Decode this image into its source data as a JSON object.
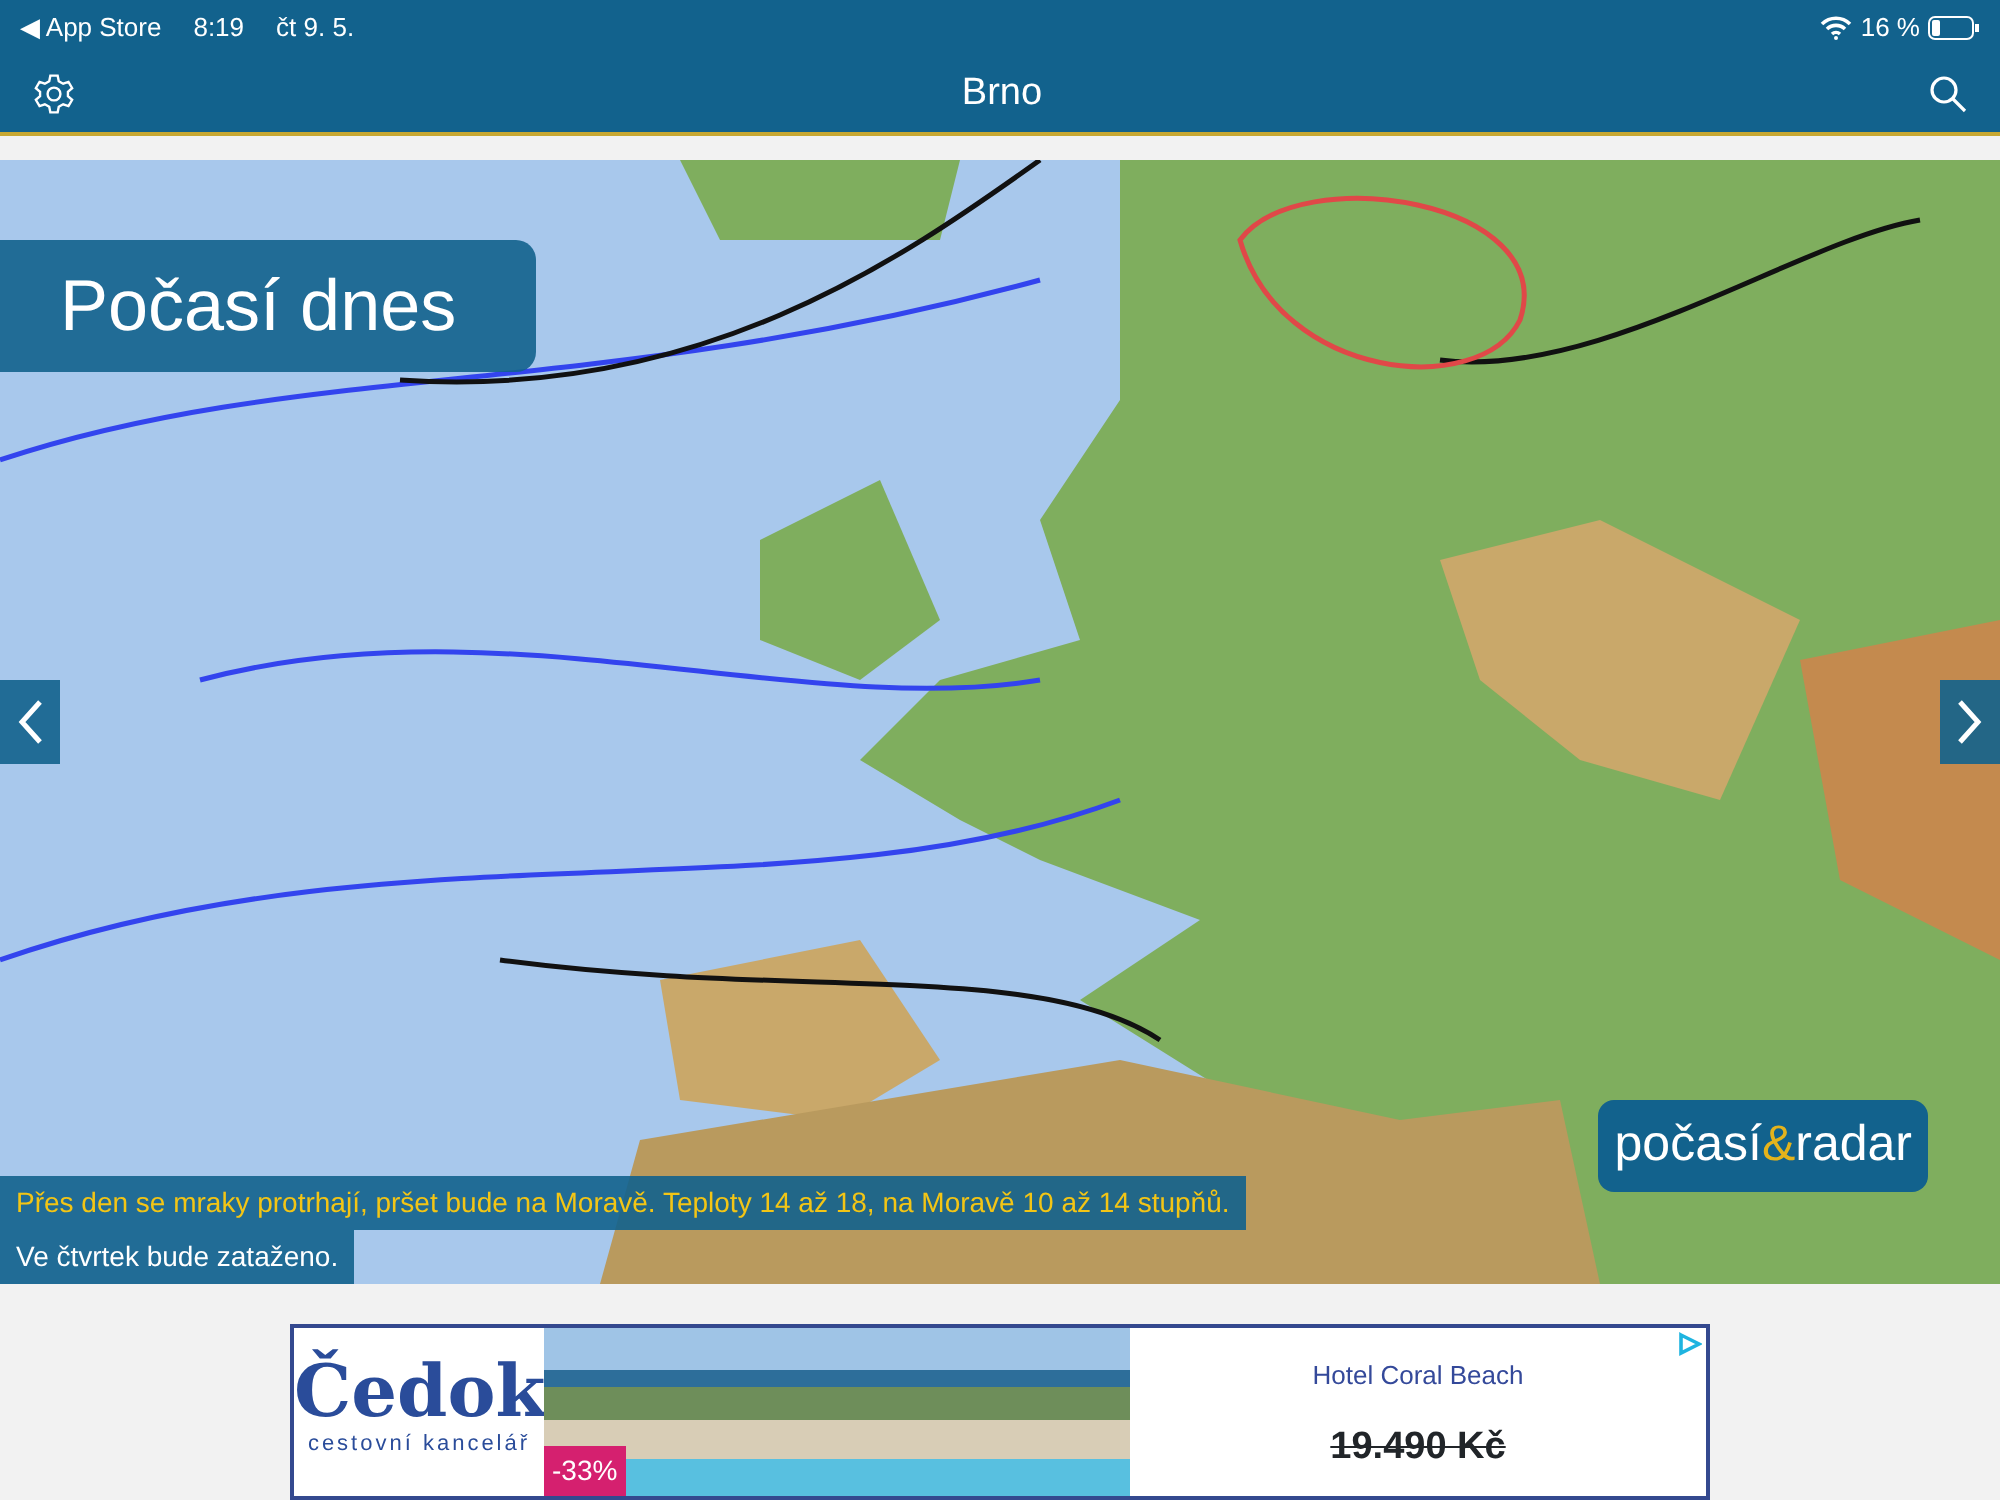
{
  "status_bar": {
    "back_label": "◀ App Store",
    "time": "8:19",
    "date": "čt 9. 5.",
    "battery": "16 %"
  },
  "header": {
    "title": "Brno"
  },
  "map": {
    "title": "Počasí dnes",
    "logo": {
      "first": "počasí",
      "amp": "&",
      "second": "radar"
    },
    "captions": [
      {
        "text": "Přes den se mraky protrhají, pršet bude na Moravě. Teploty 14 až 18, na Moravě 10 až 14 stupňů.",
        "highlight": true
      },
      {
        "text": "Ve čtvrtek bude zataženo.",
        "highlight": false
      }
    ]
  },
  "ad": {
    "brand": "Čedok",
    "brand_sub": "cestovní kancelář",
    "discount": "-33%",
    "hotel": "Hotel Coral Beach",
    "price": "19.490 Kč",
    "price_struck": true
  }
}
